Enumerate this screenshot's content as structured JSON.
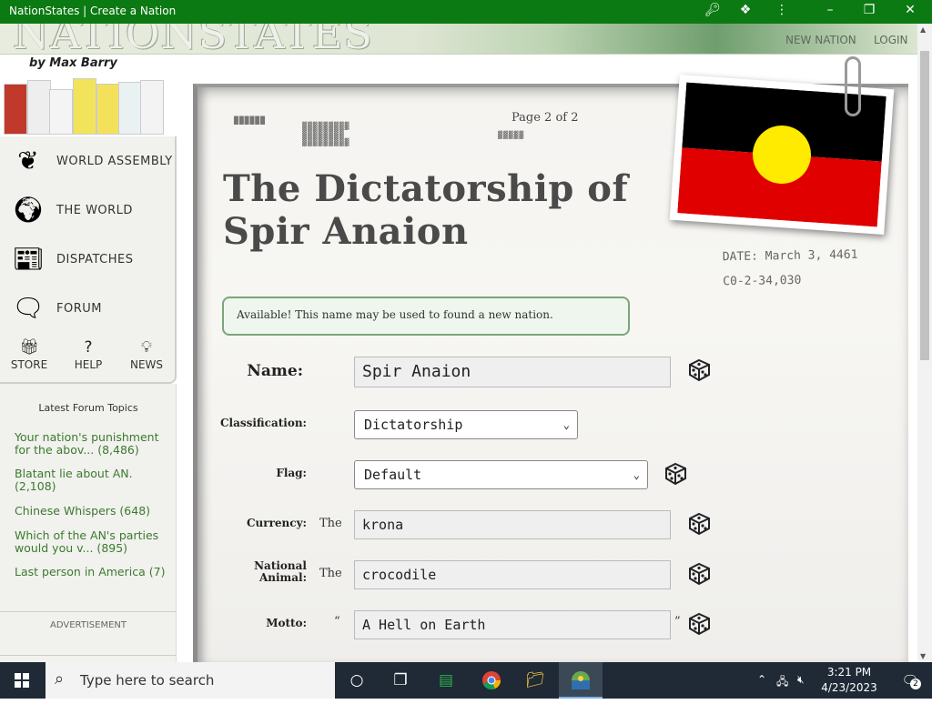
{
  "window": {
    "title": "NationStates | Create a Nation",
    "key_icon": "key-icon",
    "extensions_icon": "puzzle-icon",
    "menu_icon": "kebab-menu-icon",
    "restore_icon": "restore-window-icon",
    "close_icon": "close-icon"
  },
  "banner": {
    "logo": "NATIONSTATES",
    "new_nation": "NEW NATION",
    "login": "LOGIN"
  },
  "byline": "by Max Barry",
  "sidebar": {
    "items": [
      {
        "label": "WORLD ASSEMBLY",
        "icon": "laurel-wreath-icon"
      },
      {
        "label": "THE WORLD",
        "icon": "globe-icon"
      },
      {
        "label": "DISPATCHES",
        "icon": "newspaper-icon"
      },
      {
        "label": "FORUM",
        "icon": "speech-bubbles-icon"
      }
    ],
    "small": [
      {
        "label": "STORE",
        "icon": "gift-icon"
      },
      {
        "label": "HELP",
        "icon": "question-icon"
      },
      {
        "label": "NEWS",
        "icon": "lightbulb-icon"
      }
    ]
  },
  "forum": {
    "heading": "Latest Forum Topics",
    "topics": [
      "Your nation's punishment for the abov... (8,486)",
      "Blatant lie about AN. (2,108)",
      "Chinese Whispers (648)",
      "Which of the AN's parties would you v... (895)",
      "Last person in America (7)"
    ],
    "advertisement": "ADVERTISEMENT"
  },
  "paper": {
    "page_indicator": "Page 2 of 2",
    "heading": "The Dictatorship of Spir Anaion",
    "date_label": "DATE:",
    "date_value": "March 3, 4461",
    "ref_code": "C0-2-34,030",
    "availability": "Available! This name may be used to found a new nation."
  },
  "form": {
    "name_label": "Name:",
    "name_value": "Spir Anaion",
    "classification_label": "Classification:",
    "classification_value": "Dictatorship",
    "flag_label": "Flag:",
    "flag_value": "Default",
    "currency_label": "Currency:",
    "currency_prefix": "The",
    "currency_value": "krona",
    "animal_label": "National Animal:",
    "animal_prefix": "The",
    "animal_value": "crocodile",
    "motto_label": "Motto:",
    "motto_open_quote": "“",
    "motto_value": "A Hell on Earth",
    "motto_close_quote": "”"
  },
  "flag_colors": {
    "top": "#000000",
    "bottom": "#e10000",
    "circle": "#ffeb00"
  },
  "taskbar": {
    "search_placeholder": "Type here to search",
    "time": "3:21 PM",
    "date": "4/23/2023",
    "notifications": "2"
  }
}
